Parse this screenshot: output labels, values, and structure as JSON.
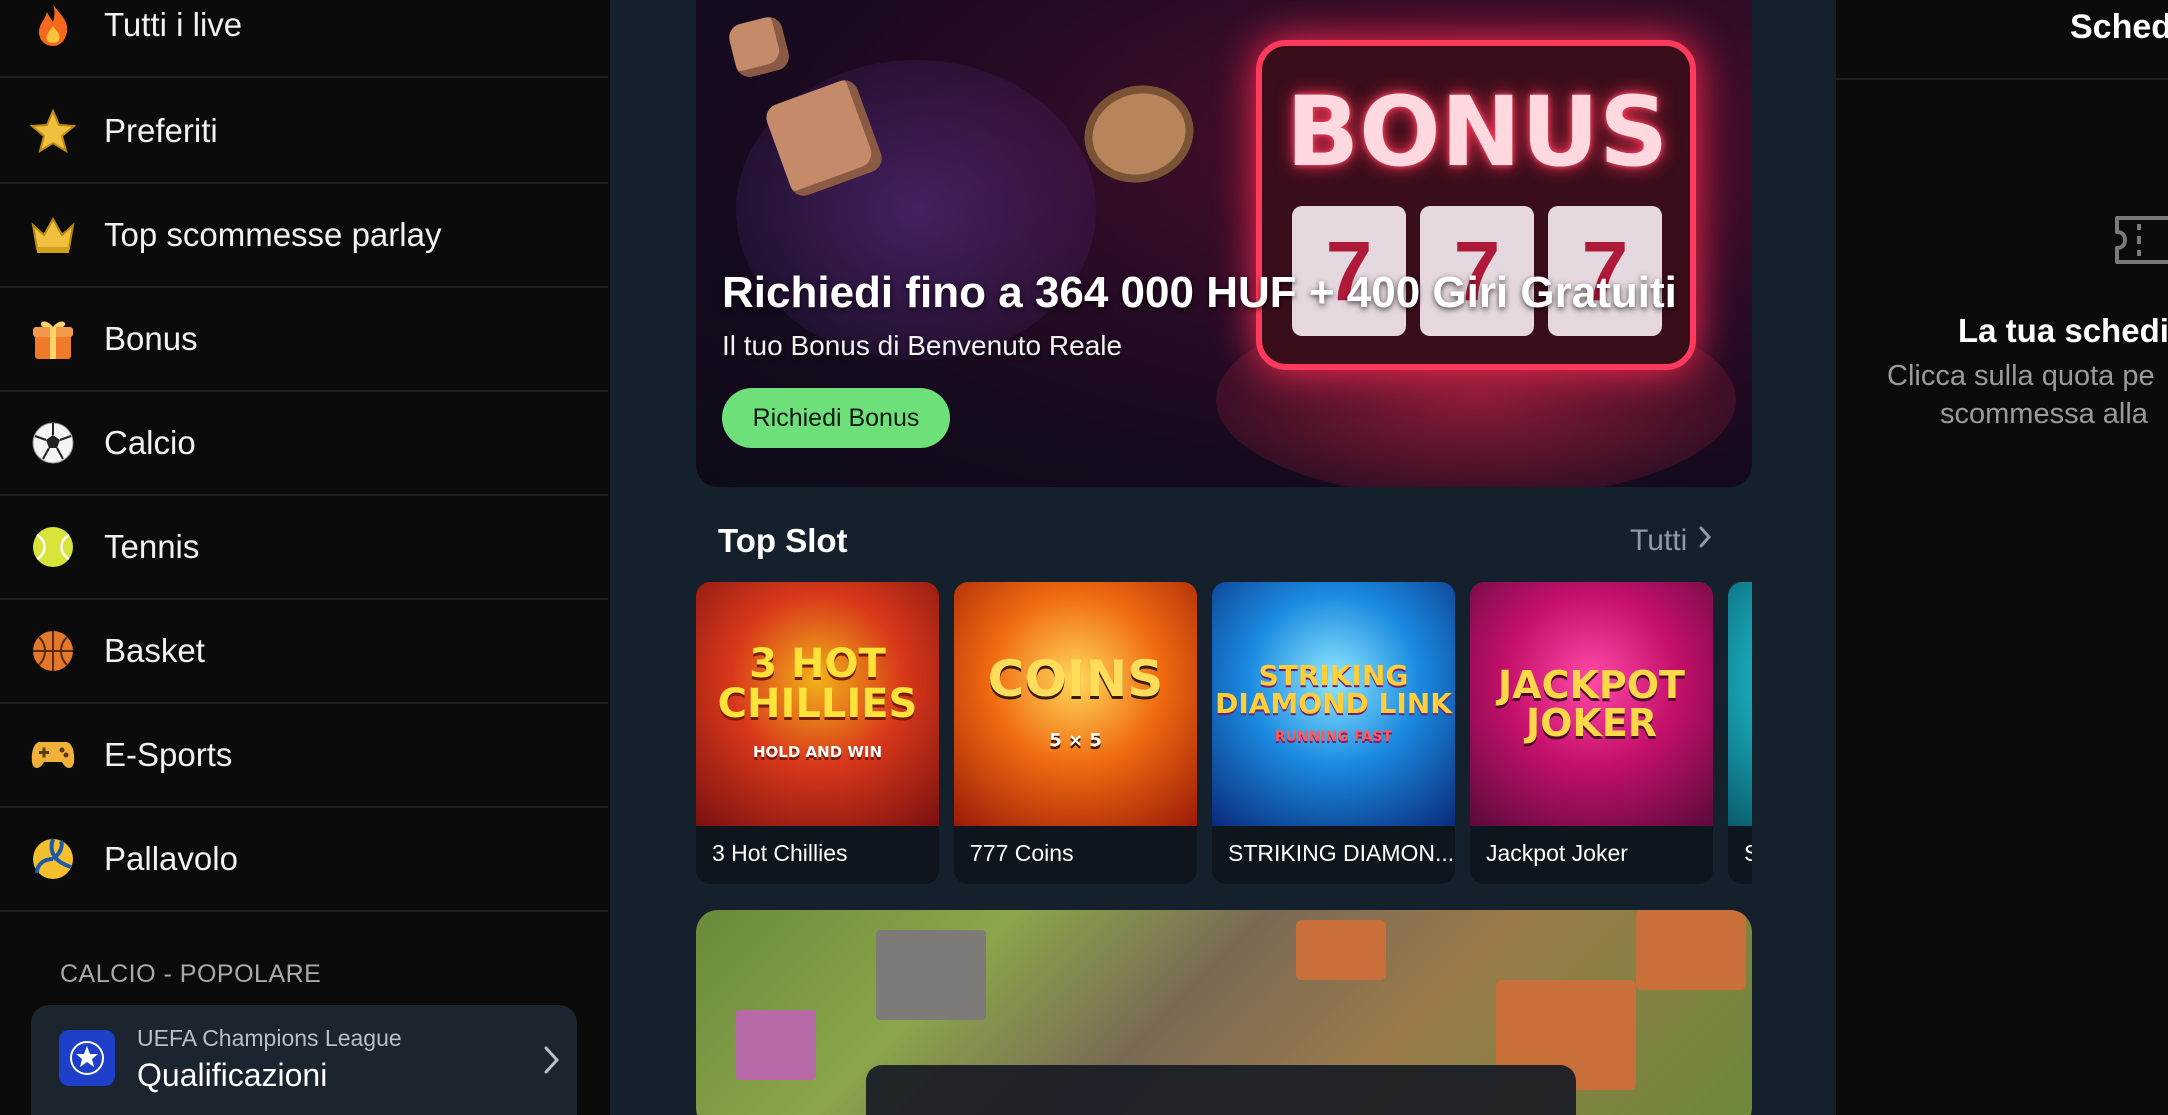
{
  "sidebar": {
    "items": [
      {
        "label": "Tutti i live",
        "icon": "fire-icon"
      },
      {
        "label": "Preferiti",
        "icon": "star-icon"
      },
      {
        "label": "Top scommesse parlay",
        "icon": "crown-icon"
      },
      {
        "label": "Bonus",
        "icon": "gift-icon"
      },
      {
        "label": "Calcio",
        "icon": "soccer-ball-icon"
      },
      {
        "label": "Tennis",
        "icon": "tennis-ball-icon"
      },
      {
        "label": "Basket",
        "icon": "basketball-icon"
      },
      {
        "label": "E-Sports",
        "icon": "gamepad-icon"
      },
      {
        "label": "Pallavolo",
        "icon": "volleyball-icon"
      }
    ],
    "section_title": "CALCIO - POPOLARE",
    "league": {
      "subtitle": "UEFA Champions League",
      "title": "Qualificazioni"
    }
  },
  "banner": {
    "title": "Richiedi fino a 364 000 HUF + 400 Giri Gratuiti",
    "subtitle": "Il tuo Bonus di Benvenuto Reale",
    "button": "Richiedi Bonus",
    "art_word": "BONUS",
    "reel_symbol": "7"
  },
  "top_slot": {
    "heading": "Top Slot",
    "see_all": "Tutti",
    "games": [
      {
        "name": "3 Hot Chillies",
        "art": "3 HOT CHILLIES",
        "art_sub": "HOLD AND WIN",
        "colors": [
          "#f2b21a",
          "#d8381a",
          "#7a1010"
        ]
      },
      {
        "name": "777 Coins",
        "art": "COINS",
        "art_sub": "5 × 5",
        "colors": [
          "#ffd85a",
          "#f06a10",
          "#9a1a08"
        ]
      },
      {
        "name": "STRIKING DIAMON...",
        "art": "STRIKING DIAMOND LINK",
        "art_sub": "RUNNING FAST",
        "colors": [
          "#8fe8ff",
          "#1a8ae0",
          "#0a2a7a"
        ]
      },
      {
        "name": "Jackpot Joker",
        "art": "JACKPOT JOKER",
        "art_sub": "",
        "colors": [
          "#ff4aa8",
          "#c4106a",
          "#5a0a3a"
        ]
      },
      {
        "name": "S",
        "art": "",
        "art_sub": "",
        "colors": [
          "#6af0e0",
          "#1ab0c0",
          "#0a5a6a"
        ]
      }
    ]
  },
  "betslip": {
    "title": "Sched",
    "empty_title": "La tua schedi",
    "empty_text_line1": "Clicca sulla quota pe",
    "empty_text_line2": "scommessa alla"
  },
  "colors": {
    "accent_green": "#6ee07a",
    "center_bg": "#14202b",
    "sidebar_bg": "#0b0b0b",
    "league_card_bg": "#1b2530"
  }
}
